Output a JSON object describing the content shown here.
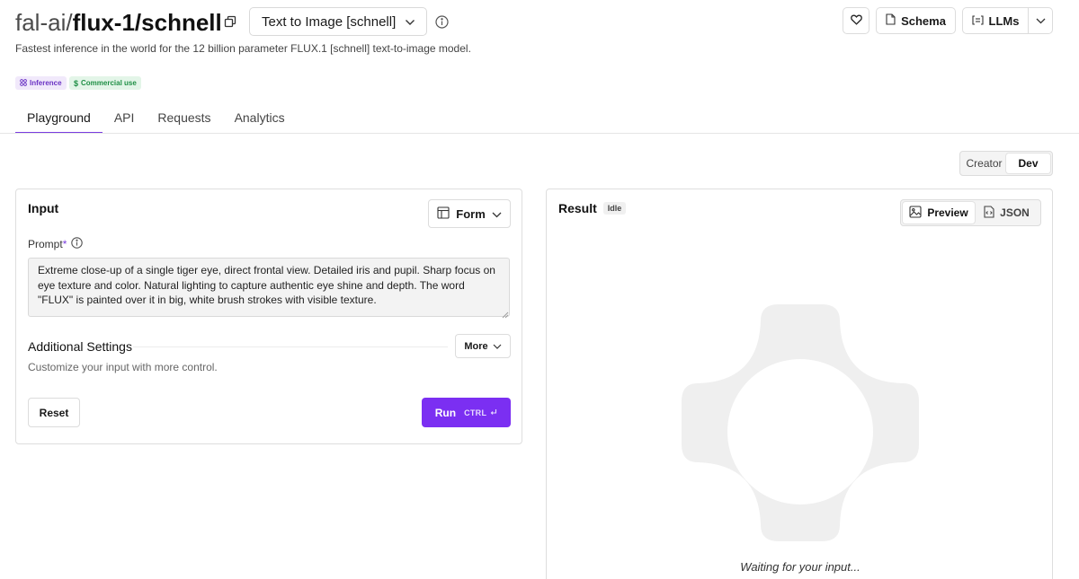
{
  "header": {
    "owner": "fal-ai/",
    "model": "flux-1/schnell",
    "endpoint_label": "Text to Image [schnell]",
    "subtitle": "Fastest inference in the world for the 12 billion parameter FLUX.1 [schnell] text-to-image model.",
    "schema_label": "Schema",
    "llms_label": "LLMs"
  },
  "badges": {
    "inference": "Inference",
    "commercial": "Commercial use"
  },
  "tabs": [
    "Playground",
    "API",
    "Requests",
    "Analytics"
  ],
  "active_tab": "Playground",
  "mode_toggle": {
    "creator": "Creator",
    "dev": "Dev",
    "active": "Dev"
  },
  "input_panel": {
    "title": "Input",
    "form_label": "Form",
    "prompt_label": "Prompt",
    "prompt_required": "*",
    "prompt_value": "Extreme close-up of a single tiger eye, direct frontal view. Detailed iris and pupil. Sharp focus on eye texture and color. Natural lighting to capture authentic eye shine and depth. The word \"FLUX\" is painted over it in big, white brush strokes with visible texture.",
    "additional_settings_title": "Additional Settings",
    "additional_settings_desc": "Customize your input with more control.",
    "more_label": "More",
    "reset_label": "Reset",
    "run_label": "Run",
    "run_shortcut": "CTRL"
  },
  "result_panel": {
    "title": "Result",
    "status": "Idle",
    "preview_label": "Preview",
    "json_label": "JSON",
    "active_view": "Preview",
    "waiting_text": "Waiting for your input..."
  },
  "colors": {
    "accent": "#7b2ff2",
    "tab_underline": "#7a3de0",
    "inference_badge_bg": "#f1e9fb",
    "commercial_badge_bg": "#e3f5e8",
    "placeholder_gray": "#efefef"
  },
  "icons": {
    "copy": "copy-icon",
    "info": "info-icon",
    "heart": "heart-icon",
    "schema": "document-icon",
    "llms": "llms-icon",
    "chevron": "chevron-down-icon",
    "form": "layout-icon",
    "preview": "image-icon",
    "json": "code-file-icon",
    "enter": "enter-key-icon"
  }
}
